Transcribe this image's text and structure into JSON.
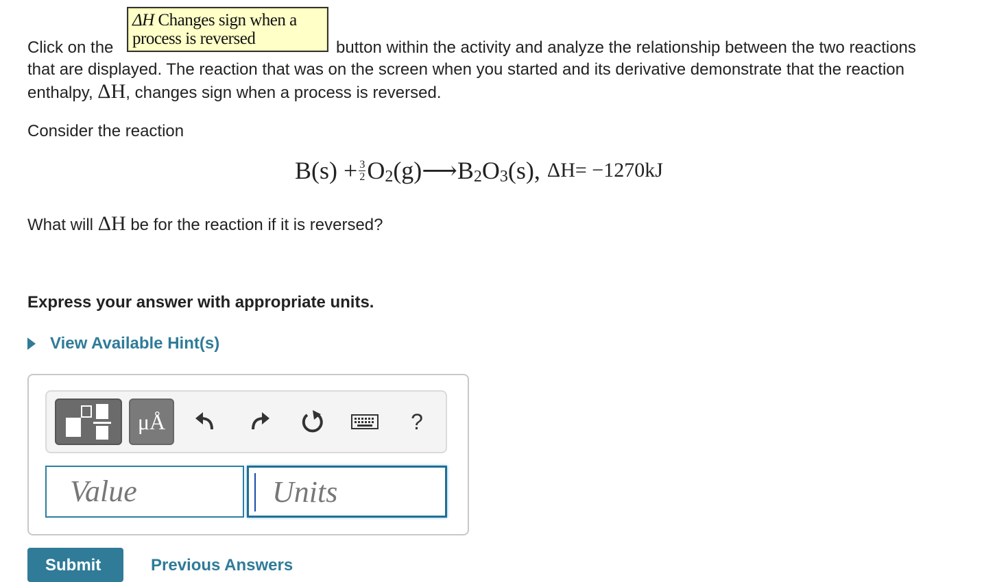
{
  "instruction": {
    "prefix": "Click on the",
    "button_label_symbol": "ΔH",
    "button_label_text": " Changes sign when a process is reversed",
    "suffix_line1": " button within the activity and analyze the relationship between the two reactions",
    "line2": "that are displayed. The reaction that was on the screen when you started and its derivative demonstrate that the reaction",
    "line3_prefix": "enthalpy, ",
    "line3_delta": "ΔH",
    "line3_suffix": ", changes sign when a process is reversed."
  },
  "consider": "Consider the reaction",
  "equation": {
    "part1": "B(s) + ",
    "frac_num": "3",
    "frac_den": "2",
    "o": "O",
    "o_sub": "2",
    "g": "(g)⟶B",
    "b_sub": "2",
    "o2": "O",
    "o2_sub": "3",
    "tail": "(s), ",
    "delta": "ΔH",
    "value": " = −1270kJ"
  },
  "question": {
    "prefix": "What will ",
    "delta": "ΔH",
    "suffix": " be for the reaction if it is reversed?"
  },
  "express": "Express your answer with appropriate units.",
  "hint_label": "View Available Hint(s)",
  "toolbar": {
    "templates_icon": "templates-icon",
    "units_label": "μÅ",
    "undo_icon": "undo-icon",
    "redo_icon": "redo-icon",
    "reset_icon": "reset-icon",
    "keyboard_icon": "keyboard-icon",
    "help_label": "?"
  },
  "fields": {
    "value_placeholder": "Value",
    "units_placeholder": "Units"
  },
  "submit_label": "Submit",
  "previous_answers_label": "Previous Answers"
}
